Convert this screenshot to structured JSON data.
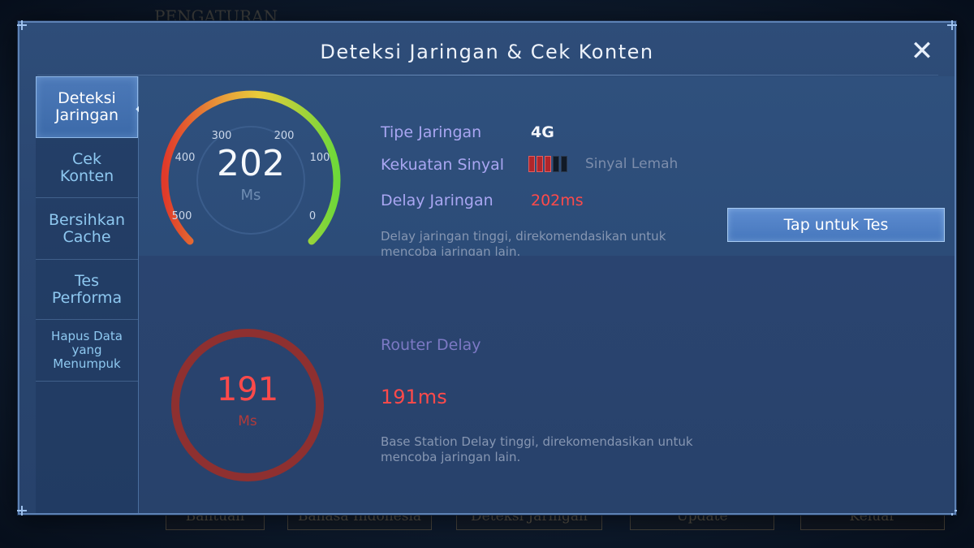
{
  "modal": {
    "title": "Deteksi Jaringan & Cek Konten",
    "close_icon": "close-icon"
  },
  "sidebar": {
    "items": [
      {
        "label": "Deteksi Jaringan",
        "active": true
      },
      {
        "label": "Cek Konten",
        "active": false
      },
      {
        "label": "Bersihkan Cache",
        "active": false
      },
      {
        "label": "Tes Performa",
        "active": false
      },
      {
        "label": "Hapus Data yang Menumpuk",
        "active": false
      }
    ]
  },
  "network": {
    "gauge": {
      "value": "202",
      "unit": "Ms",
      "reading": 202,
      "scale_max": 500,
      "ticks": [
        "500",
        "400",
        "300",
        "200",
        "100",
        "0"
      ]
    },
    "type_label": "Tipe Jaringan",
    "type_value": "4G",
    "signal_label": "Kekuatan Sinyal",
    "signal_bars_total": 5,
    "signal_bars_active": 3,
    "signal_text": "Sinyal Lemah",
    "delay_label": "Delay Jaringan",
    "delay_value": "202ms",
    "description": "Delay jaringan tinggi, direkomendasikan untuk mencoba jaringan lain.",
    "test_button": "Tap untuk Tes"
  },
  "router": {
    "value": "191",
    "unit": "Ms",
    "label": "Router Delay",
    "delay_value": "191ms",
    "description": "Base Station Delay tinggi, direkomendasikan untuk mencoba jaringan lain."
  },
  "background": {
    "buttons": [
      "Bantuan",
      "Bahasa Indonesia",
      "Deteksi Jaringan",
      "Update",
      "Keluar"
    ],
    "header_text": "PENGATURAN"
  },
  "colors": {
    "accent_red": "#ff4a4a",
    "label_purple": "#a9a6f2",
    "sidebar_text": "#8ec8f0",
    "button_blue": "#4677bd"
  }
}
